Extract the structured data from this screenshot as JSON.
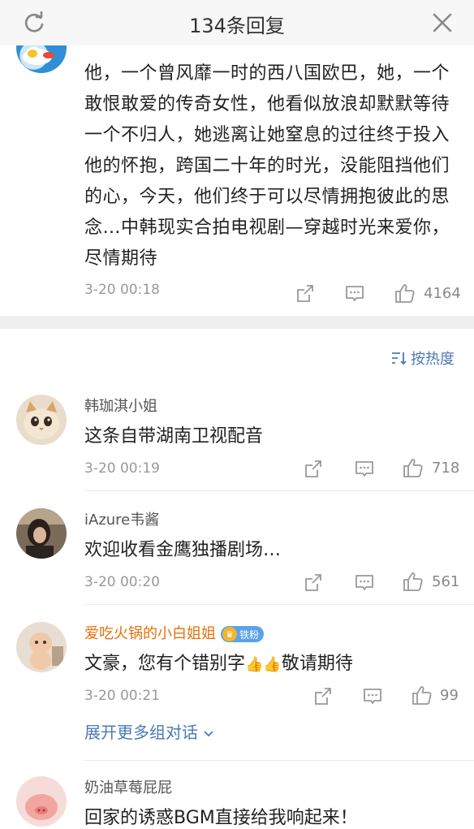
{
  "header": {
    "title": "134条回复",
    "refresh_icon": "refresh-icon",
    "close_icon": "close-icon"
  },
  "post": {
    "text": "他，一个曾风靡一时的西八国欧巴，她，一个敢恨敢爱的传奇女性，他看似放浪却默默等待一个不归人，她逃离让她窒息的过往终于投入他的怀抱，跨国二十年的时光，没能阻挡他们的心，今天，他们终于可以尽情拥抱彼此的思念…中韩现实合拍电视剧—穿越时光来爱你，尽情期待",
    "time": "3-20 00:18",
    "likes": "4164"
  },
  "sort_label": "按热度",
  "replies": [
    {
      "name": "韩珈淇小姐",
      "text": "这条自带湖南卫视配音",
      "time": "3-20 00:19",
      "likes": "718"
    },
    {
      "name": "iAzure韦酱",
      "text": "欢迎收看金鹰独播剧场…",
      "time": "3-20 00:20",
      "likes": "561"
    },
    {
      "name": "爱吃火锅的小白姐姐",
      "badge": "铁粉",
      "text_before": "文豪，您有个错别字",
      "text_after": "敬请期待",
      "emoji": "👍👍",
      "time": "3-20 00:21",
      "likes": "99"
    },
    {
      "name": "奶油草莓屁屁",
      "text": "回家的诱惑BGM直接给我响起来！"
    }
  ],
  "expand_label": "展开更多组对话",
  "colors": {
    "link": "#4a7ab5",
    "vip_name": "#e8710a",
    "badge": "#5aa2ea"
  }
}
